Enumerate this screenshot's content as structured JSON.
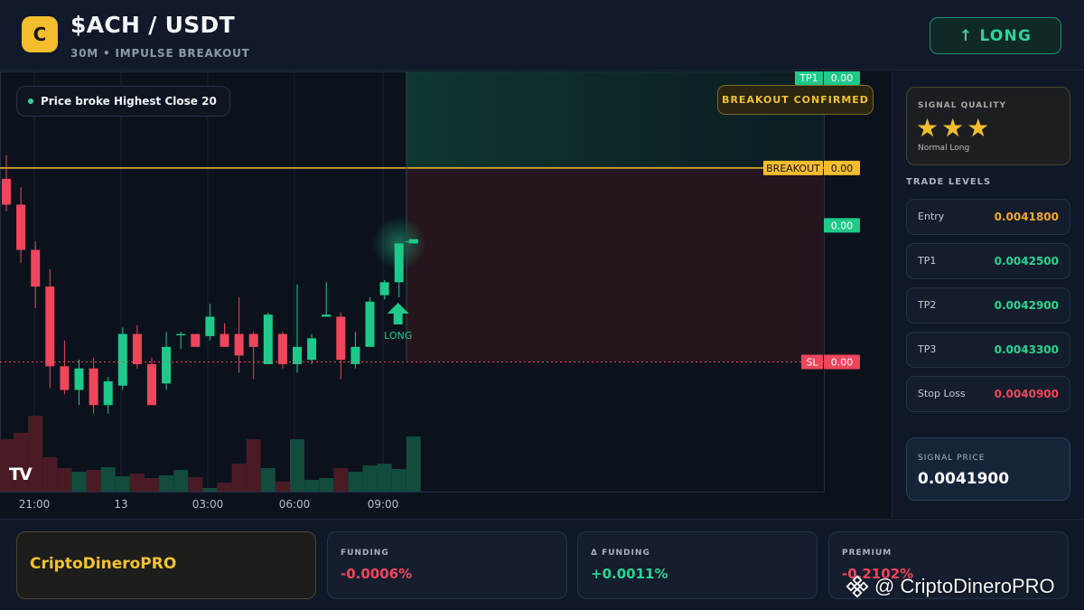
{
  "header": {
    "logo_letter": "C",
    "title": "$ACH / USDT",
    "subtitle": "30M • IMPULSE BREAKOUT",
    "direction_button": "↑ LONG"
  },
  "chart": {
    "info_pill": "Price broke Highest Close 20",
    "breakout_badge": "BREAKOUT CONFIRMED",
    "signal_marker_label": "LONG",
    "tv_logo": "TV",
    "price_tags": [
      {
        "label": "TP1",
        "value": "0.00"
      },
      {
        "label": "",
        "value": "0.00"
      },
      {
        "label": "BREAKOUT",
        "value": "0.00"
      },
      {
        "label": "SL",
        "value": "0.00"
      }
    ],
    "time_labels": [
      "21:00",
      "13",
      "03:00",
      "06:00",
      "09:00"
    ]
  },
  "chart_data": {
    "type": "candlestick",
    "candles": [
      {
        "o": 0.004175,
        "h": 0.004186,
        "l": 0.00416,
        "c": 0.004163
      },
      {
        "o": 0.004163,
        "h": 0.004171,
        "l": 0.004136,
        "c": 0.004142
      },
      {
        "o": 0.004142,
        "h": 0.004146,
        "l": 0.004115,
        "c": 0.004125
      },
      {
        "o": 0.004125,
        "h": 0.004133,
        "l": 0.004078,
        "c": 0.004088
      },
      {
        "o": 0.004088,
        "h": 0.0041,
        "l": 0.004075,
        "c": 0.004077
      },
      {
        "o": 0.004077,
        "h": 0.004091,
        "l": 0.00407,
        "c": 0.004087
      },
      {
        "o": 0.004087,
        "h": 0.004092,
        "l": 0.004066,
        "c": 0.00407
      },
      {
        "o": 0.00407,
        "h": 0.004083,
        "l": 0.004066,
        "c": 0.004081
      },
      {
        "o": 0.004079,
        "h": 0.004106,
        "l": 0.004077,
        "c": 0.004103
      },
      {
        "o": 0.004103,
        "h": 0.004107,
        "l": 0.004087,
        "c": 0.004089
      },
      {
        "o": 0.004089,
        "h": 0.004092,
        "l": 0.00407,
        "c": 0.00407
      },
      {
        "o": 0.00408,
        "h": 0.004104,
        "l": 0.004077,
        "c": 0.004097
      },
      {
        "o": 0.004103,
        "h": 0.004104,
        "l": 0.004096,
        "c": 0.004103
      },
      {
        "o": 0.004103,
        "h": 0.004103,
        "l": 0.004097,
        "c": 0.004097
      },
      {
        "o": 0.004102,
        "h": 0.004117,
        "l": 0.0041,
        "c": 0.004111
      },
      {
        "o": 0.004103,
        "h": 0.004108,
        "l": 0.004097,
        "c": 0.004097
      },
      {
        "o": 0.004103,
        "h": 0.00412,
        "l": 0.004085,
        "c": 0.004093
      },
      {
        "o": 0.004103,
        "h": 0.004104,
        "l": 0.004082,
        "c": 0.004097
      },
      {
        "o": 0.004089,
        "h": 0.004113,
        "l": 0.004089,
        "c": 0.004112
      },
      {
        "o": 0.004103,
        "h": 0.004104,
        "l": 0.004087,
        "c": 0.004089
      },
      {
        "o": 0.004089,
        "h": 0.004126,
        "l": 0.004085,
        "c": 0.004097
      },
      {
        "o": 0.004091,
        "h": 0.004103,
        "l": 0.004089,
        "c": 0.004101
      },
      {
        "o": 0.004111,
        "h": 0.004127,
        "l": 0.004111,
        "c": 0.004112
      },
      {
        "o": 0.004111,
        "h": 0.004113,
        "l": 0.004082,
        "c": 0.004091
      },
      {
        "o": 0.004089,
        "h": 0.004104,
        "l": 0.004087,
        "c": 0.004097
      },
      {
        "o": 0.004097,
        "h": 0.00412,
        "l": 0.004097,
        "c": 0.004118
      },
      {
        "o": 0.004121,
        "h": 0.004128,
        "l": 0.004119,
        "c": 0.004127
      },
      {
        "o": 0.004127,
        "h": 0.004145,
        "l": 0.00412,
        "c": 0.004145
      },
      {
        "o": 0.004145,
        "h": 0.004147,
        "l": 0.004145,
        "c": 0.004147
      }
    ],
    "volumes": [
      58,
      65,
      84,
      38,
      26,
      22,
      24,
      27,
      17,
      20,
      15,
      18,
      24,
      16,
      4,
      10,
      31,
      58,
      26,
      11,
      58,
      13,
      15,
      26,
      22,
      29,
      31,
      25,
      61
    ],
    "levels": {
      "tp1": 0.00425,
      "breakout": 0.00418,
      "sl": 0.00409
    },
    "signal_index": 27,
    "ylim": [
      0.004055,
      0.00425
    ]
  },
  "quality": {
    "label": "SIGNAL QUALITY",
    "stars": "★★★",
    "subtitle": "Normal Long"
  },
  "trade_levels": {
    "title": "TRADE LEVELS",
    "items": [
      {
        "name": "Entry",
        "value": "0.0041800",
        "color": "#f3a82e"
      },
      {
        "name": "TP1",
        "value": "0.0042500",
        "color": "#2bd492"
      },
      {
        "name": "TP2",
        "value": "0.0042900",
        "color": "#2bd492"
      },
      {
        "name": "TP3",
        "value": "0.0043300",
        "color": "#2bd492"
      },
      {
        "name": "Stop Loss",
        "value": "0.0040900",
        "color": "#f0465c"
      }
    ]
  },
  "signal_price": {
    "label": "SIGNAL PRICE",
    "value": "0.0041900"
  },
  "footer": {
    "brand": "CriptoDineroPRO",
    "metrics": [
      {
        "label": "FUNDING",
        "value": "-0.0006%",
        "color": "#f0465c"
      },
      {
        "label": "Δ FUNDING",
        "value": "+0.0011%",
        "color": "#2bd492"
      },
      {
        "label": "PREMIUM",
        "value": "-0.2102%",
        "color": "#f0465c"
      }
    ],
    "watermark": "@ CriptoDineroPRO"
  },
  "colors": {
    "bull": "#1fc98a",
    "bear": "#f0465c",
    "breakout_line": "#f3bd2e",
    "sl_line": "#f0465c"
  }
}
